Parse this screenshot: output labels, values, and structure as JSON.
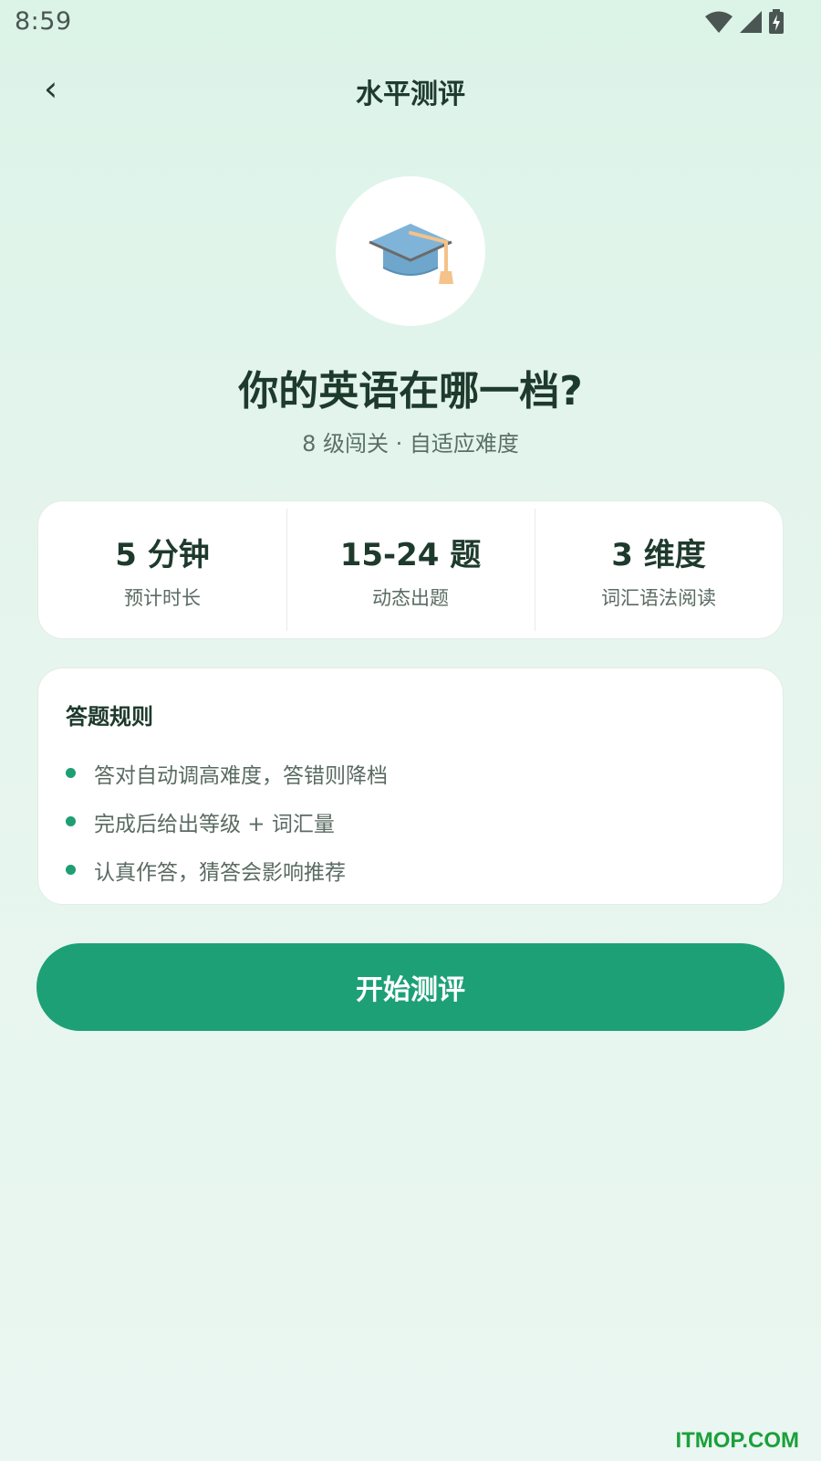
{
  "status_bar": {
    "time": "8:59",
    "icons": [
      "wifi-icon",
      "signal-icon",
      "battery-charging-icon"
    ]
  },
  "header": {
    "back_icon": "‹",
    "title": "水平测评"
  },
  "hero": {
    "icon": "graduation-cap-icon",
    "title": "你的英语在哪一档?",
    "subtitle": "8 级闯关 · 自适应难度"
  },
  "stats": [
    {
      "value": "5 分钟",
      "label": "预计时长"
    },
    {
      "value": "15-24 题",
      "label": "动态出题"
    },
    {
      "value": "3 维度",
      "label": "词汇语法阅读"
    }
  ],
  "rules": {
    "title": "答题规则",
    "items": [
      "答对自动调高难度，答错则降档",
      "完成后给出等级 + 词汇量",
      "认真作答，猜答会影响推荐"
    ]
  },
  "start_button": {
    "label": "开始测评"
  },
  "watermark": "ITMOP.COM",
  "colors": {
    "accent": "#1da076",
    "background": "#dcf3e8",
    "text": "#1e3a2d"
  }
}
